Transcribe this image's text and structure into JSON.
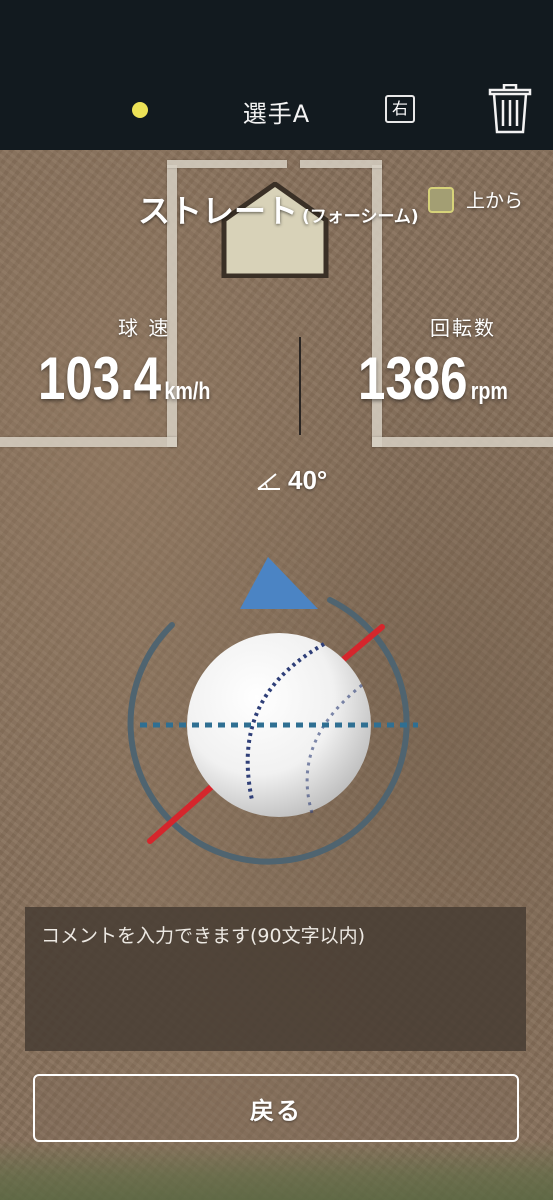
{
  "header": {
    "player_name": "選手A",
    "handedness": "右",
    "status_dot_color": "#ece257",
    "trash_icon": "trash-icon"
  },
  "pitch": {
    "type": "ストレート",
    "subtype": "(フォーシーム)",
    "view_toggle_label": "上から",
    "view_toggle_checked": false
  },
  "stats": {
    "speed_label": "球 速",
    "speed_value": "103.4",
    "speed_unit": "km/h",
    "spin_label": "回転数",
    "spin_value": "1386",
    "spin_unit": "rpm",
    "angle_value": "40°",
    "angle_icon": "angle-icon"
  },
  "comment": {
    "placeholder": "コメントを入力できます(90文字以内)"
  },
  "back_button": {
    "label": "戻る"
  },
  "colors": {
    "header_bg": "#121a1f",
    "field": "#866f5a",
    "direction_arrow": "#4b84c4",
    "spin_axis": "#d5262c",
    "ring": "#4f6470"
  }
}
